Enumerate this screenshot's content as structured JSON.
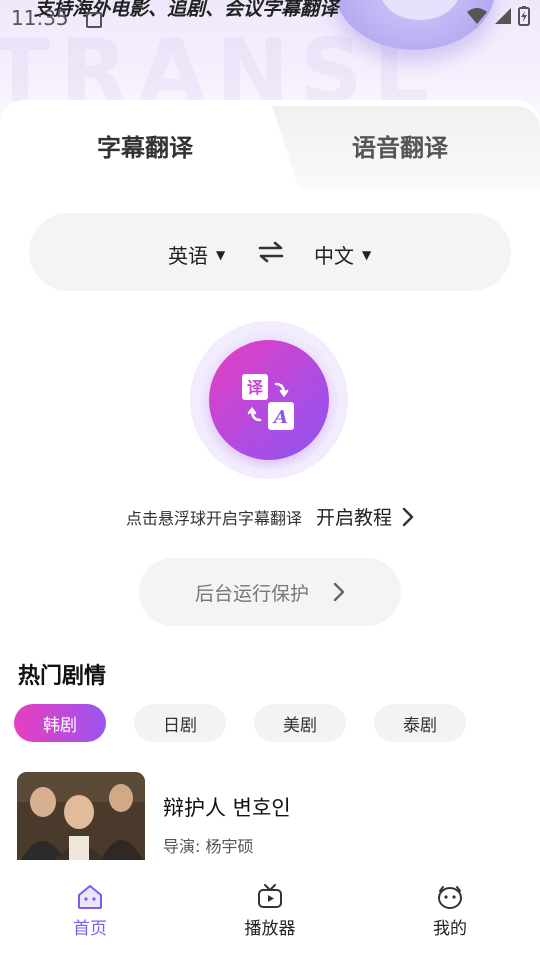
{
  "status_bar": {
    "time": "11:35"
  },
  "hero": {
    "slogan": "支持海外电影、追剧、会议字幕翻译",
    "background_text": "TRANSL"
  },
  "tabs": [
    {
      "label": "字幕翻译",
      "active": true
    },
    {
      "label": "语音翻译",
      "active": false
    }
  ],
  "language": {
    "source": "英语",
    "target": "中文"
  },
  "float_ball_hint": "点击悬浮球开启字幕翻译",
  "tutorial_label": "开启教程",
  "background_protect_label": "后台运行保护",
  "hot_dramas": {
    "title": "热门剧情",
    "categories": [
      {
        "label": "韩剧",
        "active": true
      },
      {
        "label": "日剧",
        "active": false
      },
      {
        "label": "美剧",
        "active": false
      },
      {
        "label": "泰剧",
        "active": false
      }
    ],
    "items": [
      {
        "title": "辩护人 변호인",
        "director": "导演: 杨宇硕"
      }
    ]
  },
  "bottom_nav": [
    {
      "label": "首页",
      "icon": "home-icon",
      "active": true
    },
    {
      "label": "播放器",
      "icon": "player-icon",
      "active": false
    },
    {
      "label": "我的",
      "icon": "profile-icon",
      "active": false
    }
  ],
  "colors": {
    "accent_purple": "#7d5cf0",
    "gradient_pink": "#e83dc0",
    "gradient_violet": "#9b55ee"
  }
}
